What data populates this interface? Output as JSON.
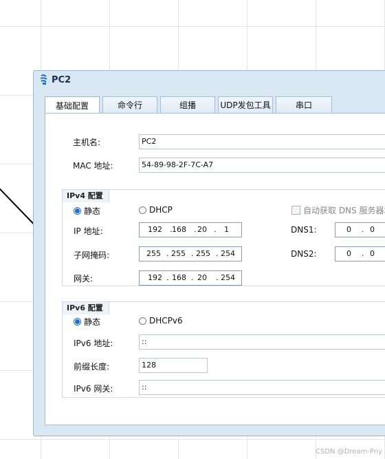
{
  "window": {
    "title": "PC2",
    "icon": "pc-icon"
  },
  "tabs": [
    {
      "label": "基础配置",
      "active": true
    },
    {
      "label": "命令行",
      "active": false
    },
    {
      "label": "组播",
      "active": false
    },
    {
      "label": "UDP发包工具",
      "active": false
    },
    {
      "label": "串口",
      "active": false
    }
  ],
  "host": {
    "label": "主机名:",
    "value": "PC2"
  },
  "mac": {
    "label": "MAC 地址:",
    "value": "54-89-98-2F-7C-A7"
  },
  "ipv4": {
    "group_title": "IPv4 配置",
    "static_label": "静态",
    "dhcp_label": "DHCP",
    "auto_dns_label": "自动获取 DNS 服务器地",
    "ip_label": "IP 地址:",
    "ip": [
      "192",
      "168",
      "20",
      "1"
    ],
    "mask_label": "子网掩码:",
    "mask": [
      "255",
      "255",
      "255",
      "254"
    ],
    "gateway_label": "网关:",
    "gateway": [
      "192",
      "168",
      "20",
      "254"
    ],
    "dns1_label": "DNS1:",
    "dns1": [
      "0",
      "0"
    ],
    "dns2_label": "DNS2:",
    "dns2": [
      "0",
      "0"
    ]
  },
  "ipv6": {
    "group_title": "IPv6 配置",
    "static_label": "静态",
    "dhcp_label": "DHCPv6",
    "ip_label": "IPv6 地址:",
    "ip_value": "::",
    "prefix_label": "前缀长度:",
    "prefix_value": "128",
    "gateway_label": "IPv6 网关:",
    "gateway_value": "::"
  },
  "watermark": "CSDN @Dream-Pny",
  "colors": {
    "accent": "#1e6fd0",
    "window_bg": "#d9e7f3",
    "tab_border": "#a7bdd3"
  }
}
